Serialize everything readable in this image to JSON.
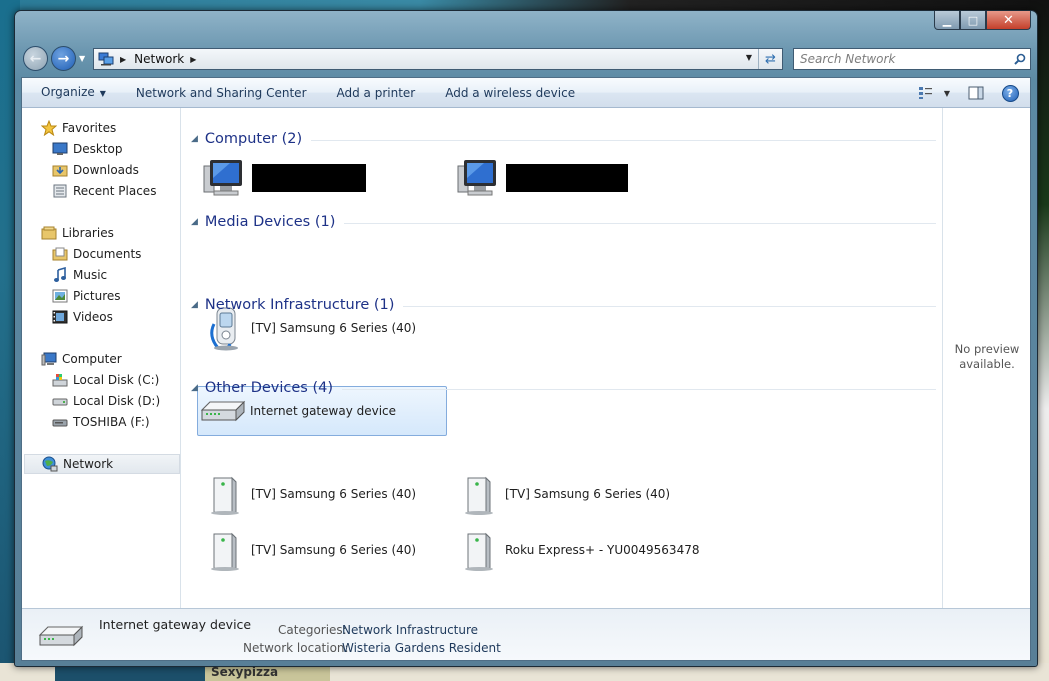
{
  "window": {
    "caption": {
      "minimize": "▁",
      "maximize": "□",
      "close": "✕"
    }
  },
  "address": {
    "crumbs": [
      "Network"
    ],
    "search_placeholder": "Search Network"
  },
  "commands": [
    "Organize",
    "Network and Sharing Center",
    "Add a printer",
    "Add a wireless device"
  ],
  "nav": {
    "favorites": {
      "label": "Favorites",
      "items": [
        "Desktop",
        "Downloads",
        "Recent Places"
      ]
    },
    "libraries": {
      "label": "Libraries",
      "items": [
        "Documents",
        "Music",
        "Pictures",
        "Videos"
      ]
    },
    "computer": {
      "label": "Computer",
      "items": [
        "Local Disk (C:)",
        "Local Disk (D:)",
        "TOSHIBA (F:)"
      ]
    },
    "network": {
      "label": "Network"
    }
  },
  "groups": {
    "computer": {
      "title": "Computer (2)"
    },
    "media": {
      "title": "Media Devices (1)",
      "items": [
        "[TV] Samsung 6 Series (40)"
      ]
    },
    "infra": {
      "title": "Network Infrastructure (1)",
      "items": [
        "Internet gateway device"
      ]
    },
    "other": {
      "title": "Other Devices (4)",
      "items": [
        "[TV] Samsung 6 Series (40)",
        "[TV] Samsung 6 Series (40)",
        "[TV] Samsung 6 Series (40)",
        "Roku Express+ - YU0049563478"
      ]
    }
  },
  "preview": {
    "text1": "No preview",
    "text2": "available."
  },
  "details": {
    "name": "Internet gateway device",
    "categories_label": "Categories:",
    "categories_value": "Network Infrastructure",
    "location_label": "Network location:",
    "location_value": "Wisteria Gardens Resident"
  },
  "background": {
    "label": "Sexypizza"
  },
  "colors": {
    "group_title": "#1e3287",
    "command_text": "#1e395b",
    "selection": "#d5e8fb"
  },
  "icons": {
    "computer": "computer-icon",
    "media": "media-device-icon",
    "router": "router-icon",
    "device": "generic-device-icon",
    "network": "network-icon",
    "star": "star-icon"
  }
}
